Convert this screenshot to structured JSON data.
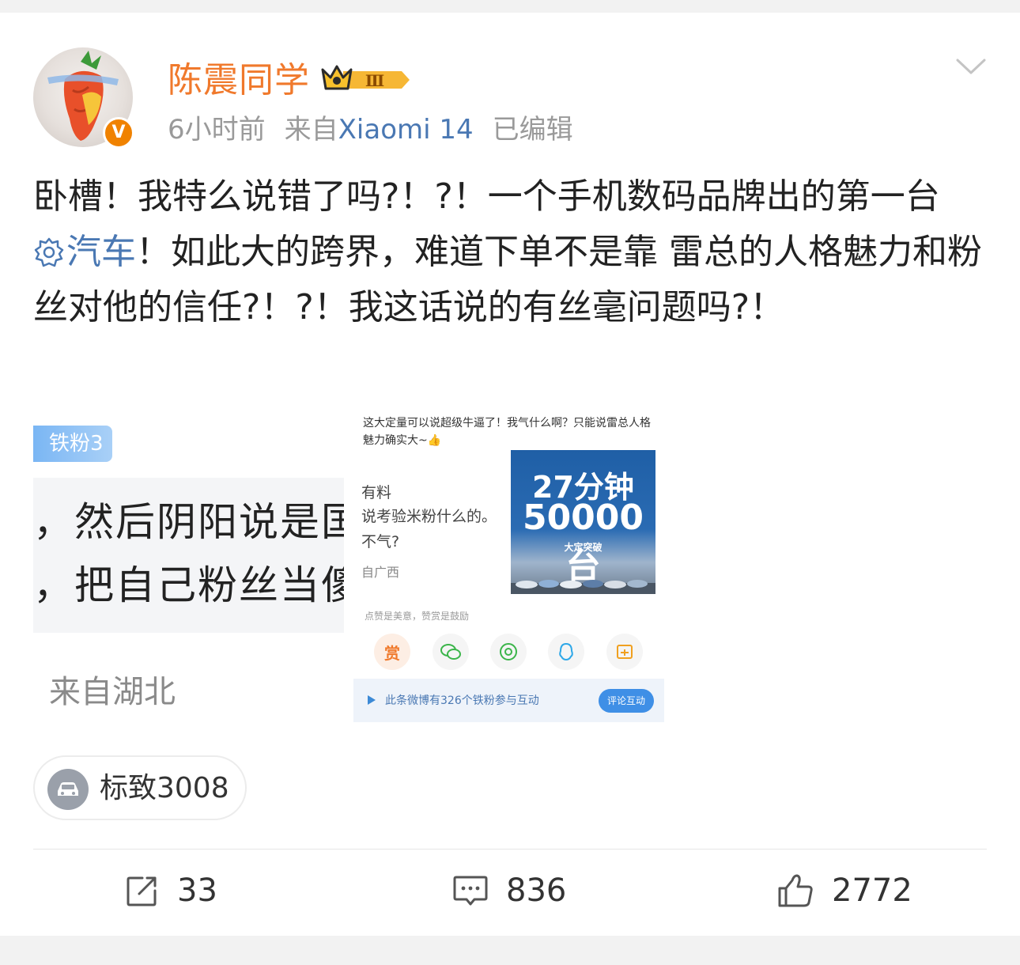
{
  "post": {
    "author": "陈震同学",
    "vip_level": "Ⅲ",
    "verified_mark": "V",
    "time": "6小时前",
    "source_prefix": "来自",
    "source_device": "Xiaomi 14",
    "edited": "已编辑",
    "text_part1": "卧槽！我特么说错了吗?！?！一个手机数码品牌出的第一台",
    "topic": "汽车",
    "text_part2": "！如此大的跨界，难道下单不是靠 雷总的人格魅力和粉丝对他的信任?！?！我这话说的有丝毫问题吗?！"
  },
  "images": {
    "img1": {
      "fan_tag": "铁粉3",
      "line1": "，然后阴阳说是国",
      "line2": "，把自己粉丝当傻",
      "location": "来自湖北"
    },
    "img2": {
      "caption": "这大定量可以说超级牛逼了！我气什么啊？只能说雷总人格魅力确实大~👍",
      "partial1": "有料",
      "partial2": "说考验米粉什么的。",
      "partial3": "不气?",
      "partial4": "自广西",
      "promo_line1": "27分钟",
      "promo_line2": "50000台",
      "promo_line3": "大定突破",
      "hint": "点赞是美意，赞赏是鼓励",
      "reward_label": "赏",
      "bar_text": "此条微博有326个铁粉参与互动",
      "bar_button": "评论互动"
    }
  },
  "tag": {
    "label": "标致3008",
    "icon": "car-icon"
  },
  "actions": {
    "repost_count": "33",
    "comment_count": "836",
    "like_count": "2772"
  },
  "colors": {
    "username": "#f0792c",
    "link": "#4a78b3",
    "verified": "#f08200",
    "meta": "#9a9a9a"
  }
}
